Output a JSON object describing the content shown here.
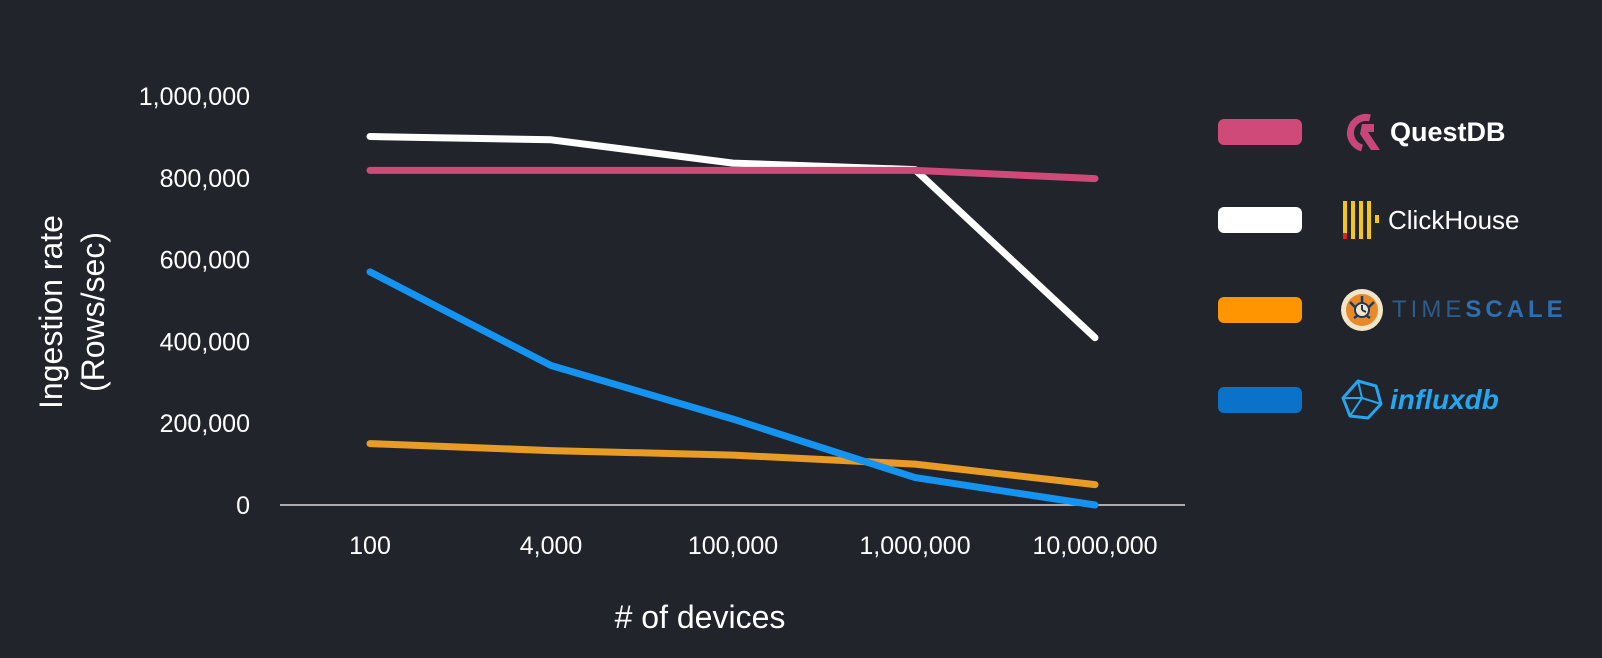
{
  "chart_data": {
    "type": "line",
    "title": "",
    "xlabel": "# of devices",
    "ylabel": "Ingestion rate",
    "ylabel_line2": "(Rows/sec)",
    "categories": [
      "100",
      "4,000",
      "100,000",
      "1,000,000",
      "10,000,000"
    ],
    "yticks": [
      "0",
      "200,000",
      "400,000",
      "600,000",
      "800,000",
      "1,000,000"
    ],
    "ylim": [
      0,
      1000000
    ],
    "grid": false,
    "legend_position": "right",
    "series": [
      {
        "name": "QuestDB",
        "color": "#cf4a78",
        "values": [
          818000,
          818000,
          818000,
          818000,
          798000
        ]
      },
      {
        "name": "ClickHouse",
        "color": "#ffffff",
        "values": [
          901000,
          893000,
          836000,
          820000,
          409000
        ]
      },
      {
        "name": "TimescaleDB",
        "color": "#e89b25",
        "values": [
          150000,
          133000,
          122000,
          100000,
          50000
        ]
      },
      {
        "name": "InfluxDB",
        "color": "#1493f0",
        "values": [
          570000,
          341000,
          210000,
          67000,
          0
        ]
      }
    ]
  },
  "legend": [
    {
      "name": "QuestDB",
      "label": "QuestDB",
      "swatch": "#cf4a78",
      "icon": "questdb-logo-icon"
    },
    {
      "name": "ClickHouse",
      "label": "ClickHouse",
      "swatch": "#ffffff",
      "icon": "clickhouse-logo-icon"
    },
    {
      "name": "Timescale",
      "label_light": "TIME",
      "label_bold": "SCALE",
      "swatch": "#ff9500",
      "icon": "timescale-tiger-logo-icon"
    },
    {
      "name": "InfluxDB",
      "label": "influxdb",
      "swatch": "#0b72c9",
      "icon": "influxdb-logo-icon"
    }
  ]
}
